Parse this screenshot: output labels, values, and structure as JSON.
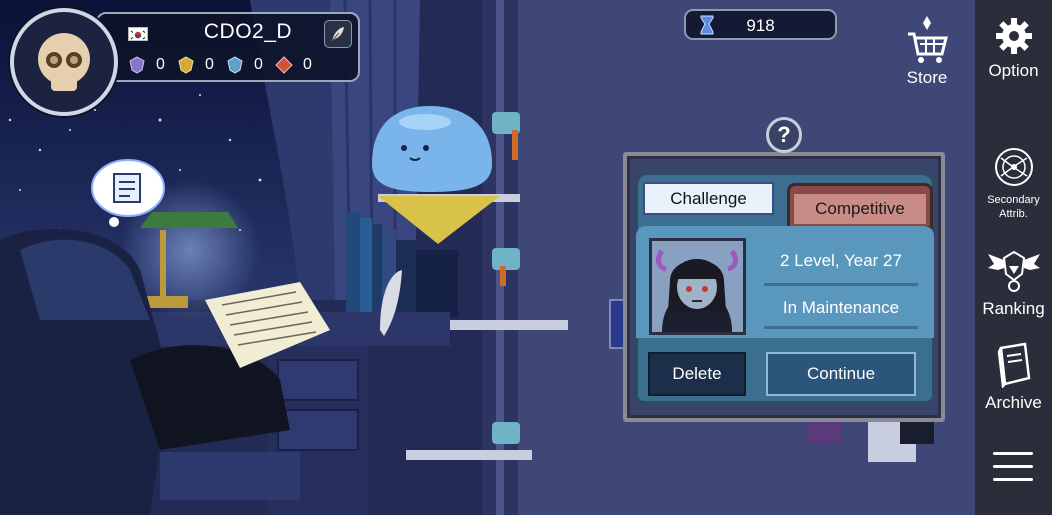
{
  "player": {
    "name": "CDO2_D",
    "stats": [
      {
        "icon": "purple-crest-icon",
        "value": "0"
      },
      {
        "icon": "gold-crest-icon",
        "value": "0"
      },
      {
        "icon": "blue-crest-icon",
        "value": "0"
      },
      {
        "icon": "red-crest-icon",
        "value": "0"
      }
    ]
  },
  "currency": {
    "icon": "hourglass-icon",
    "value": "918"
  },
  "store": {
    "label": "Store"
  },
  "sidebar": {
    "option": "Option",
    "secondary": "Secondary Attrib.",
    "ranking": "Ranking",
    "archive": "Archive"
  },
  "board": {
    "help": "?",
    "tabs": {
      "challenge": "Challenge",
      "competitive": "Competitive"
    },
    "level": "2 Level, Year 27",
    "status": "In Maintenance",
    "delete": "Delete",
    "continue": "Continue"
  },
  "colors": {
    "accent": "#5a97bd",
    "sidebar": "#2a2d3a",
    "competitive_tab": "#c88b85"
  }
}
